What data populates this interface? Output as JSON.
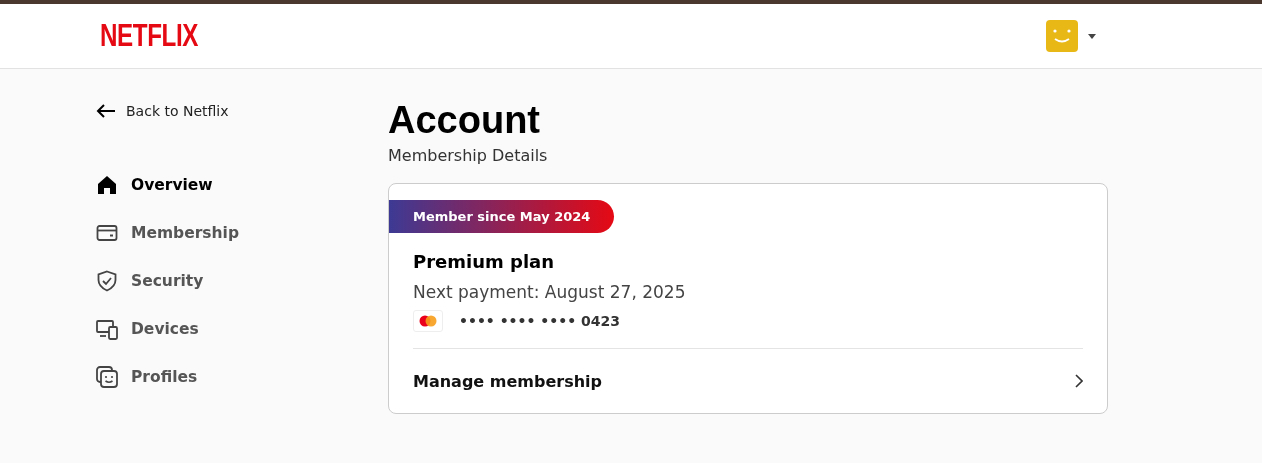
{
  "header": {
    "logo": "NETFLIX"
  },
  "sidebar": {
    "back_link": "Back to Netflix",
    "items": [
      {
        "label": "Overview",
        "kind": "home",
        "selected": true
      },
      {
        "label": "Membership",
        "kind": "card",
        "selected": false
      },
      {
        "label": "Security",
        "kind": "shield",
        "selected": false
      },
      {
        "label": "Devices",
        "kind": "devices",
        "selected": false
      },
      {
        "label": "Profiles",
        "kind": "profiles",
        "selected": false
      }
    ]
  },
  "main": {
    "title": "Account",
    "subtitle": "Membership Details",
    "card": {
      "badge": "Member since May 2024",
      "plan": "Premium plan",
      "next_payment": "Next payment: August 27, 2025",
      "card_number": "•••• •••• •••• 0423",
      "action": "Manage membership"
    }
  }
}
